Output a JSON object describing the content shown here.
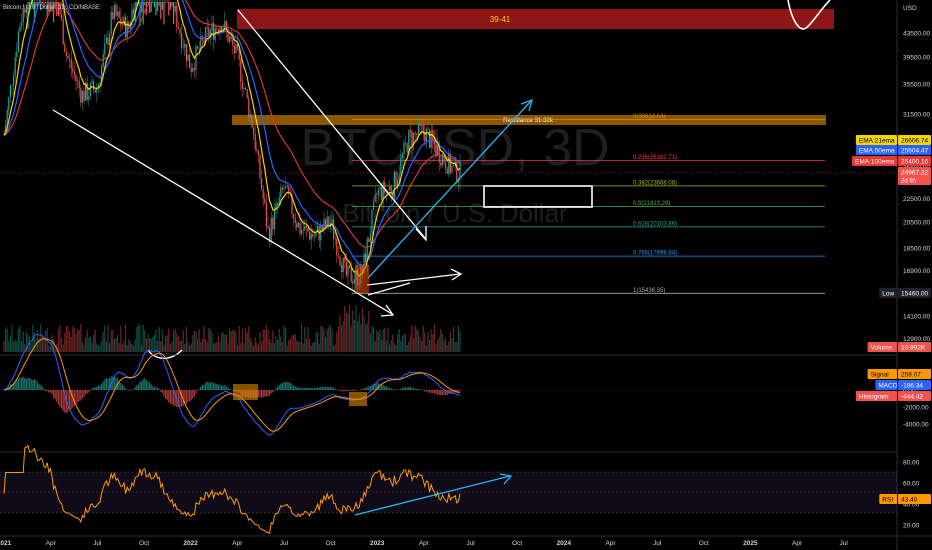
{
  "header": {
    "symbol_title": "Bitcoin / U.S. Dollar, 3D, COINBASE",
    "currency": "USD"
  },
  "watermark": {
    "ticker": "BTCUSD, 3D",
    "name": "Bitcoin / U.S. Dollar"
  },
  "colors": {
    "background": "#000000",
    "candle_up": "#26a69a",
    "candle_down": "#ef5350",
    "ema21": "#f5d400",
    "ema50": "#2962ff",
    "ema100": "#e53935",
    "fib_orange": "#e08a00",
    "fib_red": "#f23645",
    "fib_olive": "#a8b800",
    "fib_green": "#4caf50",
    "fib_teal": "#26a69a",
    "fib_blue": "#2196f3",
    "fib_gray": "#aaaaaa",
    "zone_red": "#b71c1c",
    "rsi": "#ff9800",
    "macd": "#2962ff",
    "signal": "#ff9800",
    "arrow_white": "#ffffff",
    "arrow_cyan": "#29b6f6"
  },
  "price_axis": {
    "labels": [
      "43500.00",
      "39500.00",
      "35500.00",
      "31500.00",
      "28500.00",
      "25500.00",
      "22500.00",
      "20500.00",
      "18500.00",
      "16900.00",
      "14100.00",
      "12900.00"
    ]
  },
  "price_badges": [
    {
      "name": "ema21-badge",
      "label": "EMA:21ema",
      "value": "26606.74",
      "color": "#f5d400",
      "text": "#000000"
    },
    {
      "name": "ema50-badge",
      "label": "EMA:50ema",
      "value": "25604.47",
      "color": "#2962ff",
      "text": "#ffffff"
    },
    {
      "name": "ema100-badge",
      "label": "EMA:100ema",
      "value": "25400.16",
      "color": "#e53935",
      "text": "#ffffff"
    },
    {
      "name": "last-price-badge",
      "value": "24967.32",
      "sub": "2d 9h",
      "color": "#ef5350",
      "text": "#ffffff"
    },
    {
      "name": "low-badge",
      "label": "Low",
      "value": "15460.00",
      "color": "#1e222d",
      "text": "#ffffff"
    },
    {
      "name": "volume-badge",
      "label": "Volume",
      "value": "10.992K",
      "color": "#ef5350",
      "text": "#ffffff"
    }
  ],
  "zones": {
    "top_zone_label": "39-41",
    "resistance_label": "Resistance 31-32k"
  },
  "fib_levels": [
    {
      "label": "0(30824.64)",
      "price": 30824.64,
      "color": "#e08a00"
    },
    {
      "label": "0.236(26182.71)",
      "price": 26182.71,
      "color": "#f23645"
    },
    {
      "label": "0.382(23668.08)",
      "price": 23668.08,
      "color": "#a8b800"
    },
    {
      "label": "0.5(21813.29)",
      "price": 21813.29,
      "color": "#4caf50"
    },
    {
      "label": "0.618(20103.86)",
      "price": 20103.86,
      "color": "#26a69a"
    },
    {
      "label": "0.786(17898.64)",
      "price": 17898.64,
      "color": "#2196f3"
    },
    {
      "label": "1(15436.35)",
      "price": 15436.35,
      "color": "#aaaaaa"
    }
  ],
  "macd_panel": {
    "axis_labels": [
      "2000.00",
      "0.00",
      "-2000.00",
      "-4000.00"
    ],
    "badges": [
      {
        "name": "signal-badge",
        "label": "Signal",
        "value": "258.07",
        "color": "#ff9800",
        "text": "#000000"
      },
      {
        "name": "macd-badge",
        "label": "MACD",
        "value": "-186.34",
        "color": "#2962ff",
        "text": "#ffffff"
      },
      {
        "name": "histogram-badge",
        "label": "Histogram",
        "value": "-444.42",
        "color": "#ef5350",
        "text": "#ffffff"
      }
    ]
  },
  "rsi_panel": {
    "axis_labels": [
      "80.00",
      "60.00",
      "40.00",
      "20.00"
    ],
    "badge": {
      "label": "RSI",
      "value": "43.40",
      "color": "#ff9800",
      "text": "#000000"
    }
  },
  "time_axis": {
    "labels": [
      "2021",
      "Apr",
      "Jul",
      "Oct",
      "2022",
      "Apr",
      "Jul",
      "Oct",
      "2023",
      "Apr",
      "Jul",
      "Oct",
      "2024",
      "Apr",
      "Jul",
      "Oct",
      "2025",
      "Apr",
      "Jul"
    ]
  },
  "chart_data": {
    "type": "candlestick",
    "title": "Bitcoin / U.S. Dollar, 3D, COINBASE",
    "y_unit": "USD",
    "ylim": [
      12000,
      47000
    ],
    "y_scale": "log",
    "x_range": [
      "2021-01",
      "2025-08"
    ],
    "price_path": [
      {
        "date": "2021-01",
        "price": 29000
      },
      {
        "date": "2021-02",
        "price": 45000
      },
      {
        "date": "2021-03",
        "price": 57000
      },
      {
        "date": "2021-04",
        "price": 60000
      },
      {
        "date": "2021-05",
        "price": 40000
      },
      {
        "date": "2021-06",
        "price": 34000
      },
      {
        "date": "2021-07",
        "price": 35000
      },
      {
        "date": "2021-08",
        "price": 47000
      },
      {
        "date": "2021-09",
        "price": 44000
      },
      {
        "date": "2021-10",
        "price": 61000
      },
      {
        "date": "2021-11",
        "price": 62000
      },
      {
        "date": "2021-12",
        "price": 47000
      },
      {
        "date": "2022-01",
        "price": 38000
      },
      {
        "date": "2022-02",
        "price": 43000
      },
      {
        "date": "2022-03",
        "price": 45500
      },
      {
        "date": "2022-04",
        "price": 39500
      },
      {
        "date": "2022-05",
        "price": 30000
      },
      {
        "date": "2022-06",
        "price": 19500
      },
      {
        "date": "2022-07",
        "price": 23500
      },
      {
        "date": "2022-08",
        "price": 20000
      },
      {
        "date": "2022-09",
        "price": 19400
      },
      {
        "date": "2022-10",
        "price": 20500
      },
      {
        "date": "2022-11",
        "price": 16500
      },
      {
        "date": "2022-12",
        "price": 16600
      },
      {
        "date": "2023-01",
        "price": 23000
      },
      {
        "date": "2023-02",
        "price": 23500
      },
      {
        "date": "2023-03",
        "price": 28500
      },
      {
        "date": "2023-04",
        "price": 29500
      },
      {
        "date": "2023-05",
        "price": 27000
      },
      {
        "date": "2023-06",
        "price": 25000
      }
    ],
    "series": [
      {
        "name": "EMA:21ema",
        "last": 26606.74
      },
      {
        "name": "EMA:50ema",
        "last": 25604.47
      },
      {
        "name": "EMA:100ema",
        "last": 25400.16
      }
    ],
    "last_price": 24967.32,
    "low": 15460.0,
    "volume_last": "10.992K",
    "macd": {
      "signal": 258.07,
      "macd": -186.34,
      "histogram": -444.42,
      "ylim": [
        -5000,
        3000
      ]
    },
    "rsi": {
      "value": 43.4,
      "ylim": [
        20,
        80
      ]
    },
    "annotations": [
      "39-41",
      "Resistance 31-32k"
    ]
  }
}
